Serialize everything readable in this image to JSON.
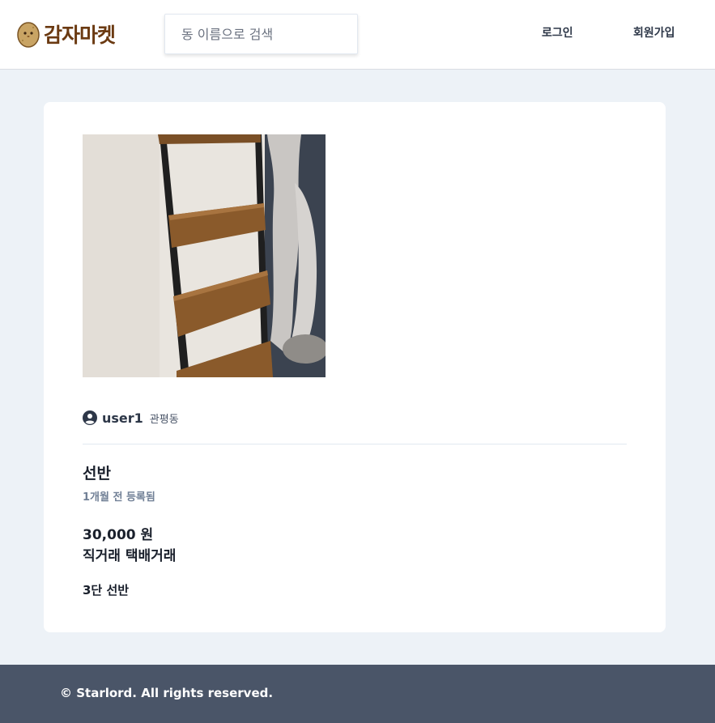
{
  "header": {
    "logo_text": "감자마켓",
    "logo_icon": "potato-icon",
    "search_placeholder": "동 이름으로 검색",
    "login_label": "로그인",
    "signup_label": "회원가입"
  },
  "product": {
    "image_icon": "product-photo",
    "seller": {
      "icon": "user-circle-icon",
      "username": "user1",
      "region": "관평동"
    },
    "title": "선반",
    "posted": "1개월 전 등록됨",
    "price": "30,000 원",
    "trade_methods": "직거래 택배거래",
    "description": "3단 선반"
  },
  "footer": {
    "copyright": "© Starlord. All rights reserved."
  },
  "colors": {
    "page_bg": "#edf2f7",
    "footer_bg": "#4a5568",
    "logo_brown": "#6b3a12"
  }
}
